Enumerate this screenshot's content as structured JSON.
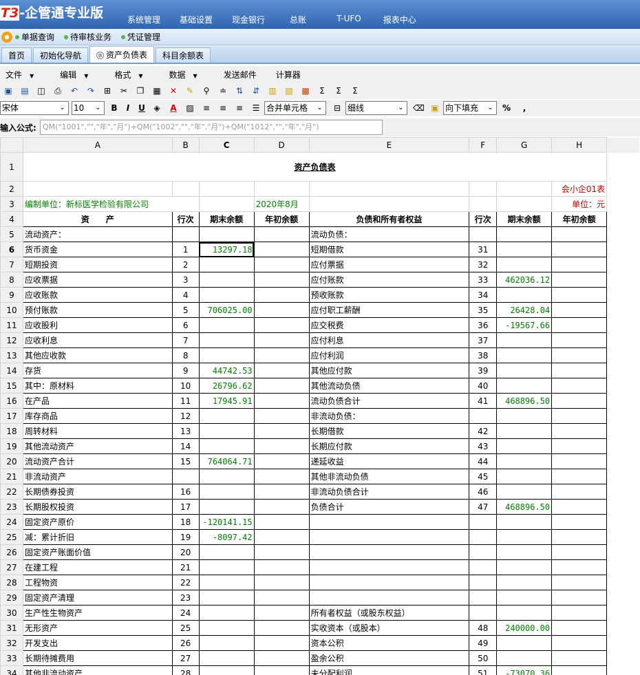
{
  "app": {
    "logo_prefix": "T3",
    "logo_text": "-企管通专业版"
  },
  "main_nav": [
    "系统管理",
    "基础设置",
    "现金银行",
    "总账",
    "T-UFO",
    "报表中心"
  ],
  "sub_nav": [
    "单据查询",
    "待审核业务",
    "凭证管理"
  ],
  "tabs": [
    {
      "label": "首页"
    },
    {
      "label": "初始化导航"
    },
    {
      "label": "资产负债表",
      "close": "⊗"
    },
    {
      "label": "科目余额表"
    }
  ],
  "menu": [
    {
      "label": "文件",
      "arrow": "▼"
    },
    {
      "label": "编辑",
      "arrow": "▼"
    },
    {
      "label": "格式",
      "arrow": "▼"
    },
    {
      "label": "数据",
      "arrow": "▼"
    },
    {
      "label": "发送邮件",
      "arrow": ""
    },
    {
      "label": "计算器",
      "arrow": ""
    }
  ],
  "toolbar2": {
    "font": "宋体",
    "size": "10",
    "bold": "B",
    "italic": "I",
    "underline": "U",
    "merge": "合并单元格",
    "line": "细线",
    "fill": "向下填充",
    "percent": "%",
    "comma": ","
  },
  "formula": {
    "label": "输入公式:",
    "value": "QM(\"1001\",\"\",\"年\",\"月\")+QM(\"1002\",\"\",\"年\",\"月\")+QM(\"1012\",\"\",\"年\",\"月\")"
  },
  "columns": [
    "A",
    "B",
    "C",
    "D",
    "E",
    "F",
    "G",
    "H"
  ],
  "sheet": {
    "title": "资产负债表",
    "form_no": "会小企01表",
    "company": "编制单位：新标医学检验有限公司",
    "period": "2020年8月",
    "unit": "单位：元",
    "headers": [
      "资　　产",
      "行次",
      "期末余额",
      "年初余额",
      "负债和所有者权益",
      "行次",
      "期末余额",
      "年初余额"
    ],
    "rows": [
      {
        "r": "5",
        "a": "流动资产：",
        "b": "",
        "c": "",
        "e": "流动负债：",
        "f": "",
        "g": ""
      },
      {
        "r": "6",
        "a": "货币资金",
        "b": "1",
        "c": "13297.18",
        "e": "短期借款",
        "f": "31",
        "g": ""
      },
      {
        "r": "7",
        "a": "短期投资",
        "b": "2",
        "c": "",
        "e": "应付票据",
        "f": "32",
        "g": ""
      },
      {
        "r": "8",
        "a": "应收票据",
        "b": "3",
        "c": "",
        "e": "应付账款",
        "f": "33",
        "g": "462036.12"
      },
      {
        "r": "9",
        "a": "应收账款",
        "b": "4",
        "c": "",
        "e": "预收账款",
        "f": "34",
        "g": ""
      },
      {
        "r": "10",
        "a": "预付账款",
        "b": "5",
        "c": "706025.00",
        "e": "应付职工薪酬",
        "f": "35",
        "g": "26428.04"
      },
      {
        "r": "11",
        "a": "应收股利",
        "b": "6",
        "c": "",
        "e": "应交税费",
        "f": "36",
        "g": "-19567.66"
      },
      {
        "r": "12",
        "a": "应收利息",
        "b": "7",
        "c": "",
        "e": "应付利息",
        "f": "37",
        "g": ""
      },
      {
        "r": "13",
        "a": "其他应收款",
        "b": "8",
        "c": "",
        "e": "应付利润",
        "f": "38",
        "g": ""
      },
      {
        "r": "14",
        "a": "存货",
        "b": "9",
        "c": "44742.53",
        "e": "其他应付款",
        "f": "39",
        "g": ""
      },
      {
        "r": "15",
        "a": "其中：原材料",
        "b": "10",
        "c": "26796.62",
        "e": "其他流动负债",
        "f": "40",
        "g": ""
      },
      {
        "r": "16",
        "a": "在产品",
        "b": "11",
        "c": "17945.91",
        "e": "流动负债合计",
        "f": "41",
        "g": "468896.50"
      },
      {
        "r": "17",
        "a": "库存商品",
        "b": "12",
        "c": "",
        "e": "非流动负债：",
        "f": "",
        "g": ""
      },
      {
        "r": "18",
        "a": "周转材料",
        "b": "13",
        "c": "",
        "e": "长期借款",
        "f": "42",
        "g": ""
      },
      {
        "r": "19",
        "a": "其他流动资产",
        "b": "14",
        "c": "",
        "e": "长期应付款",
        "f": "43",
        "g": ""
      },
      {
        "r": "20",
        "a": "流动资产合计",
        "b": "15",
        "c": "764064.71",
        "e": "递延收益",
        "f": "44",
        "g": ""
      },
      {
        "r": "21",
        "a": "非流动资产",
        "b": "",
        "c": "",
        "e": "其他非流动负债",
        "f": "45",
        "g": ""
      },
      {
        "r": "22",
        "a": "长期债券投资",
        "b": "16",
        "c": "",
        "e": "非流动负债合计",
        "f": "46",
        "g": ""
      },
      {
        "r": "23",
        "a": "长期股权投资",
        "b": "17",
        "c": "",
        "e": "负债合计",
        "f": "47",
        "g": "468896.50"
      },
      {
        "r": "24",
        "a": "固定资产原价",
        "b": "18",
        "c": "-120141.15",
        "e": "",
        "f": "",
        "g": ""
      },
      {
        "r": "25",
        "a": "减：累计折旧",
        "b": "19",
        "c": "-8097.42",
        "e": "",
        "f": "",
        "g": ""
      },
      {
        "r": "26",
        "a": "固定资产账面价值",
        "b": "20",
        "c": "",
        "e": "",
        "f": "",
        "g": ""
      },
      {
        "r": "27",
        "a": "在建工程",
        "b": "21",
        "c": "",
        "e": "",
        "f": "",
        "g": ""
      },
      {
        "r": "28",
        "a": "工程物资",
        "b": "22",
        "c": "",
        "e": "",
        "f": "",
        "g": ""
      },
      {
        "r": "29",
        "a": "固定资产清理",
        "b": "23",
        "c": "",
        "e": "",
        "f": "",
        "g": ""
      },
      {
        "r": "30",
        "a": "生产性生物资产",
        "b": "24",
        "c": "",
        "e": "所有者权益（或股东权益）",
        "f": "",
        "g": ""
      },
      {
        "r": "31",
        "a": "无形资产",
        "b": "25",
        "c": "",
        "e": "实收资本（或股本）",
        "f": "48",
        "g": "240000.00"
      },
      {
        "r": "32",
        "a": "开发支出",
        "b": "26",
        "c": "",
        "e": "资本公积",
        "f": "49",
        "g": ""
      },
      {
        "r": "33",
        "a": "长期待摊费用",
        "b": "27",
        "c": "",
        "e": "盈余公积",
        "f": "50",
        "g": ""
      },
      {
        "r": "34",
        "a": "其他非流动资产",
        "b": "28",
        "c": "",
        "e": "未分配利润",
        "f": "51",
        "g": "-73070.36"
      }
    ]
  }
}
